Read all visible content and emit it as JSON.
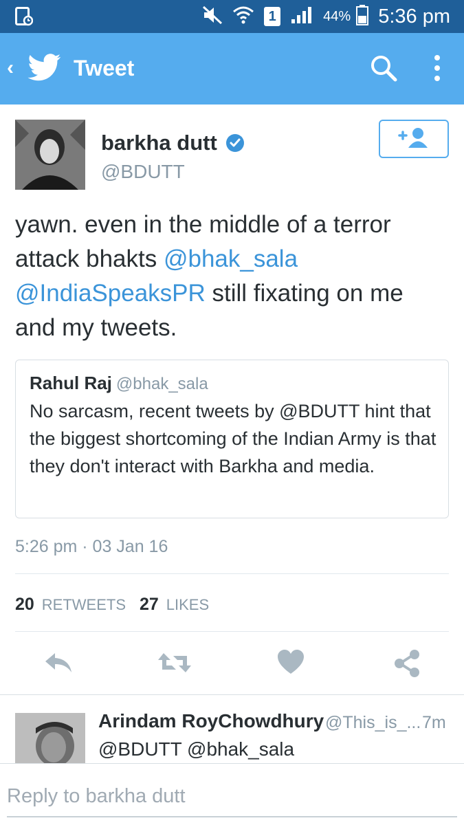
{
  "status_bar": {
    "battery_percent": "44%",
    "sim_label": "1",
    "time": "5:36 pm"
  },
  "app_bar": {
    "title": "Tweet",
    "icons": [
      "back-icon",
      "twitter-bird-icon",
      "search-icon",
      "more-vert-icon"
    ]
  },
  "tweet": {
    "author_name": "barkha dutt",
    "author_handle": "@BDUTT",
    "text_before": "yawn. even in the middle of a terror attack bhakts ",
    "mention_1": "@bhak_sala",
    "mention_2": "@IndiaSpeaksPR",
    "text_after": " still fixating on me and my tweets.",
    "timestamp": "5:26 pm · 03 Jan 16",
    "retweets_count": "20",
    "retweets_label": "RETWEETS",
    "likes_count": "27",
    "likes_label": "LIKES",
    "quoted": {
      "name": "Rahul Raj",
      "handle": "@bhak_sala",
      "text": "No sarcasm, recent tweets by @BDUTT hint that the biggest shortcoming of the Indian Army is that they don't interact with Barkha and media."
    }
  },
  "reply_item": {
    "name": "Arindam RoyChowdhury",
    "handle": "@This_is_...",
    "time": "7m",
    "text": "@BDUTT @bhak_sala"
  },
  "reply_box": {
    "placeholder": "Reply to barkha dutt"
  },
  "colors": {
    "status_bar": "#1f5f99",
    "app_bar": "#55acee",
    "link": "#3b94d9",
    "muted": "#8899a6",
    "action_icon": "#aab8c2"
  }
}
